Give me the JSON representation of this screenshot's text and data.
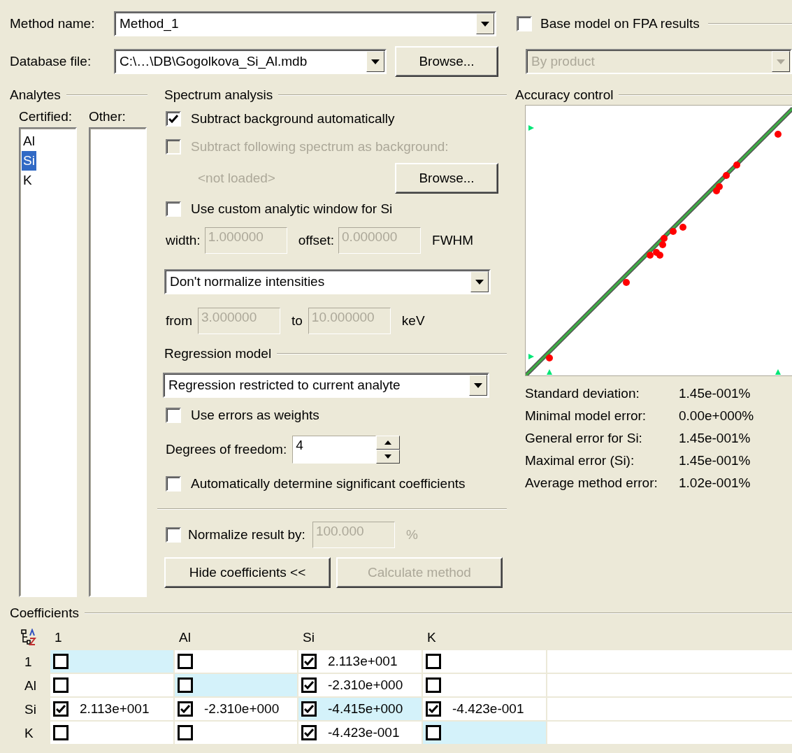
{
  "method_name": {
    "label": "Method name:",
    "value": "Method_1"
  },
  "database_file": {
    "label": "Database file:",
    "value": "C:\\…\\DB\\Gogolkova_Si_Al.mdb",
    "browse": "Browse..."
  },
  "base_model": {
    "label": "Base model on FPA results",
    "checked": false
  },
  "product_select": {
    "value": "By product",
    "disabled": true
  },
  "analytes": {
    "title": "Analytes",
    "certified_label": "Certified:",
    "other_label": "Other:",
    "certified": [
      {
        "label": "Al",
        "selected": false
      },
      {
        "label": "Si",
        "selected": true
      },
      {
        "label": "K",
        "selected": false
      }
    ]
  },
  "spectrum_analysis": {
    "title": "Spectrum analysis",
    "subtract_background": {
      "label": "Subtract background automatically",
      "checked": true,
      "disabled": false
    },
    "subtract_spectrum": {
      "label": "Subtract following spectrum as background:",
      "checked": false,
      "disabled": true
    },
    "spectrum_file": {
      "value": "<not loaded>",
      "browse": "Browse..."
    },
    "custom_window": {
      "label": "Use custom analytic window for Si",
      "checked": false,
      "disabled": false
    },
    "width": {
      "label": "width:",
      "value": "1.000000",
      "disabled": true
    },
    "offset": {
      "label": "offset:",
      "value": "0.000000",
      "disabled": true
    },
    "window_unit": "FWHM",
    "normalize_select": "Don't normalize intensities",
    "from": {
      "label": "from",
      "value": "3.000000",
      "disabled": true
    },
    "to": {
      "label": "to",
      "value": "10.000000",
      "disabled": true
    },
    "range_unit": "keV"
  },
  "regression_model": {
    "title": "Regression model",
    "select": "Regression restricted to current analyte",
    "use_errors": {
      "label": "Use errors as weights",
      "checked": false,
      "disabled": false
    },
    "degrees": {
      "label": "Degrees of freedom:",
      "value": "4"
    },
    "auto_coefficients": {
      "label": "Automatically determine significant coefficients",
      "checked": false,
      "disabled": false
    },
    "normalize_result": {
      "label": "Normalize result by:",
      "checked": false,
      "disabled": false
    },
    "normalize_value": {
      "value": "100.000",
      "disabled": true,
      "unit": "%"
    },
    "buttons": [
      {
        "label": "Hide coefficients <<",
        "disabled": false
      },
      {
        "label": "Calculate method",
        "disabled": true
      }
    ]
  },
  "accuracy_control": {
    "title": "Accuracy control",
    "stats": [
      {
        "label": "Standard deviation:",
        "value": "1.45e-001%"
      },
      {
        "label": "Minimal model error:",
        "value": "0.00e+000%"
      },
      {
        "label": "General error for Si:",
        "value": "1.45e-001%"
      },
      {
        "label": "Maximal error (Si):",
        "value": "1.45e-001%"
      },
      {
        "label": "Average method error:",
        "value": "1.02e-001%"
      }
    ]
  },
  "coefficients": {
    "title": "Coefficients",
    "columns": [
      "1",
      "Al",
      "Si",
      "K"
    ],
    "rows": [
      {
        "label": "1",
        "cells": [
          {
            "checked": false,
            "highlighted": true
          },
          {
            "checked": false,
            "highlighted": false
          },
          {
            "checked": true,
            "value": "2.113e+001",
            "highlighted": false
          },
          {
            "checked": false,
            "highlighted": false
          }
        ]
      },
      {
        "label": "Al",
        "cells": [
          {
            "checked": false,
            "highlighted": false
          },
          {
            "checked": false,
            "highlighted": true
          },
          {
            "checked": true,
            "value": "-2.310e+000",
            "highlighted": false
          },
          {
            "checked": false,
            "highlighted": false
          }
        ]
      },
      {
        "label": "Si",
        "cells": [
          {
            "checked": true,
            "value": "2.113e+001",
            "highlighted": false
          },
          {
            "checked": true,
            "value": "-2.310e+000",
            "highlighted": false
          },
          {
            "checked": true,
            "value": "-4.415e+000",
            "highlighted": true
          },
          {
            "checked": true,
            "value": "-4.423e-001",
            "highlighted": false
          }
        ]
      },
      {
        "label": "K",
        "cells": [
          {
            "checked": false,
            "highlighted": false
          },
          {
            "checked": false,
            "highlighted": false
          },
          {
            "checked": true,
            "value": "-4.423e-001",
            "highlighted": false
          },
          {
            "checked": false,
            "highlighted": true
          }
        ]
      }
    ]
  }
}
